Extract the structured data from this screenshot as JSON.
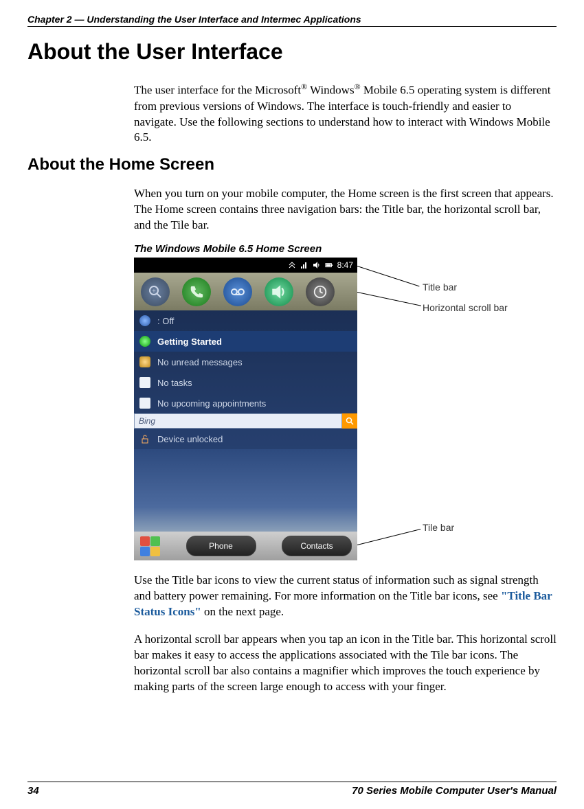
{
  "chapter_head": "Chapter 2 — Understanding the User Interface and Intermec Applications",
  "title": "About the User Interface",
  "intro_html": "The user interface for the Microsoft",
  "intro_reg1": "®",
  "intro_mid": " Windows",
  "intro_reg2": "®",
  "intro_rest": " Mobile 6.5 operating system is different from previous versions of Windows. The interface is touch-friendly and easier to navigate. Use the following sections to understand how to interact with Windows Mobile 6.5.",
  "subtitle": "About the Home Screen",
  "para2": "When you turn on your mobile computer, the Home screen is the first screen that appears. The Home screen contains three navigation bars: the Title bar, the horizontal scroll bar, and the Tile bar.",
  "fig_caption": "The Windows Mobile 6.5 Home Screen",
  "callouts": {
    "title_bar": "Title bar",
    "hscroll": "Horizontal scroll bar",
    "tile_bar": "Tile bar"
  },
  "phone": {
    "time": "8:47",
    "rows": {
      "bt": ": Off",
      "getting_started": "Getting Started",
      "messages": "No unread messages",
      "tasks": "No tasks",
      "appts": "No upcoming appointments",
      "bing": "Bing",
      "unlocked": "Device unlocked"
    },
    "tiles": {
      "phone": "Phone",
      "contacts": "Contacts"
    }
  },
  "para3_pre": "Use the Title bar icons to view the current status of information such as signal strength and battery power remaining. For more information on the Title bar icons, see ",
  "para3_link": "\"Title Bar Status Icons\"",
  "para3_post": " on the next page.",
  "para4": "A horizontal scroll bar appears when you tap an icon in the Title bar. This horizontal scroll bar makes it easy to access the applications associated with the Tile bar icons. The horizontal scroll bar also contains a magnifier which improves the touch experience by making parts of the screen large enough to access with your finger.",
  "footer": {
    "page": "34",
    "manual": "70 Series Mobile Computer User's Manual"
  }
}
